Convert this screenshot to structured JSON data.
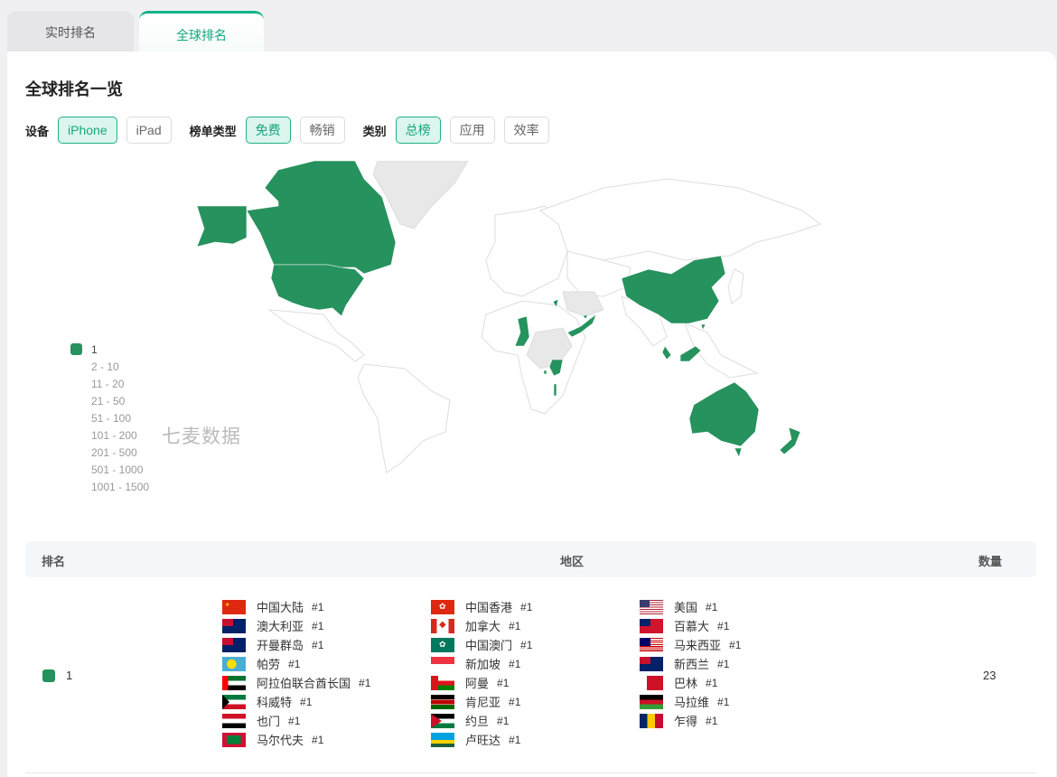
{
  "tabs": [
    {
      "label": "实时排名",
      "active": false
    },
    {
      "label": "全球排名",
      "active": true
    }
  ],
  "title": "全球排名一览",
  "filters": {
    "device": {
      "label": "设备",
      "options": [
        "iPhone",
        "iPad"
      ],
      "selected": "iPhone"
    },
    "chart_type": {
      "label": "榜单类型",
      "options": [
        "免费",
        "畅销"
      ],
      "selected": "免费"
    },
    "category": {
      "label": "类别",
      "options": [
        "总榜",
        "应用",
        "效率"
      ],
      "selected": "总榜"
    }
  },
  "map": {
    "watermark": "七麦数据",
    "colors": {
      "rank_1": "#26925d",
      "other_ranked": "#e8e8e8",
      "unranked": "#ffffff",
      "border": "#dddddd"
    },
    "legend": [
      "1",
      "2 - 10",
      "11 - 20",
      "21 - 50",
      "51 - 100",
      "101 - 200",
      "201 - 500",
      "501 - 1000",
      "1001 - 1500"
    ]
  },
  "table": {
    "headers": {
      "rank": "排名",
      "region": "地区",
      "count": "数量"
    },
    "rows": [
      {
        "rank": "1",
        "count": "23",
        "regions": [
          {
            "name": "中国大陆",
            "rank": "#1",
            "flag": "cn"
          },
          {
            "name": "澳大利亚",
            "rank": "#1",
            "flag": "au"
          },
          {
            "name": "开曼群岛",
            "rank": "#1",
            "flag": "ky"
          },
          {
            "name": "帕劳",
            "rank": "#1",
            "flag": "pw"
          },
          {
            "name": "阿拉伯联合酋长国",
            "rank": "#1",
            "flag": "ae"
          },
          {
            "name": "科威特",
            "rank": "#1",
            "flag": "kw"
          },
          {
            "name": "也门",
            "rank": "#1",
            "flag": "ye"
          },
          {
            "name": "马尔代夫",
            "rank": "#1",
            "flag": "mv"
          },
          {
            "name": "中国香港",
            "rank": "#1",
            "flag": "hk"
          },
          {
            "name": "加拿大",
            "rank": "#1",
            "flag": "ca"
          },
          {
            "name": "中国澳门",
            "rank": "#1",
            "flag": "mo"
          },
          {
            "name": "新加坡",
            "rank": "#1",
            "flag": "sg"
          },
          {
            "name": "阿曼",
            "rank": "#1",
            "flag": "om"
          },
          {
            "name": "肯尼亚",
            "rank": "#1",
            "flag": "ke"
          },
          {
            "name": "约旦",
            "rank": "#1",
            "flag": "jo"
          },
          {
            "name": "卢旺达",
            "rank": "#1",
            "flag": "rw"
          },
          {
            "name": "美国",
            "rank": "#1",
            "flag": "us"
          },
          {
            "name": "百慕大",
            "rank": "#1",
            "flag": "bm"
          },
          {
            "name": "马来西亚",
            "rank": "#1",
            "flag": "my"
          },
          {
            "name": "新西兰",
            "rank": "#1",
            "flag": "nz"
          },
          {
            "name": "巴林",
            "rank": "#1",
            "flag": "bh"
          },
          {
            "name": "马拉维",
            "rank": "#1",
            "flag": "mw"
          },
          {
            "name": "乍得",
            "rank": "#1",
            "flag": "td"
          }
        ]
      }
    ]
  }
}
